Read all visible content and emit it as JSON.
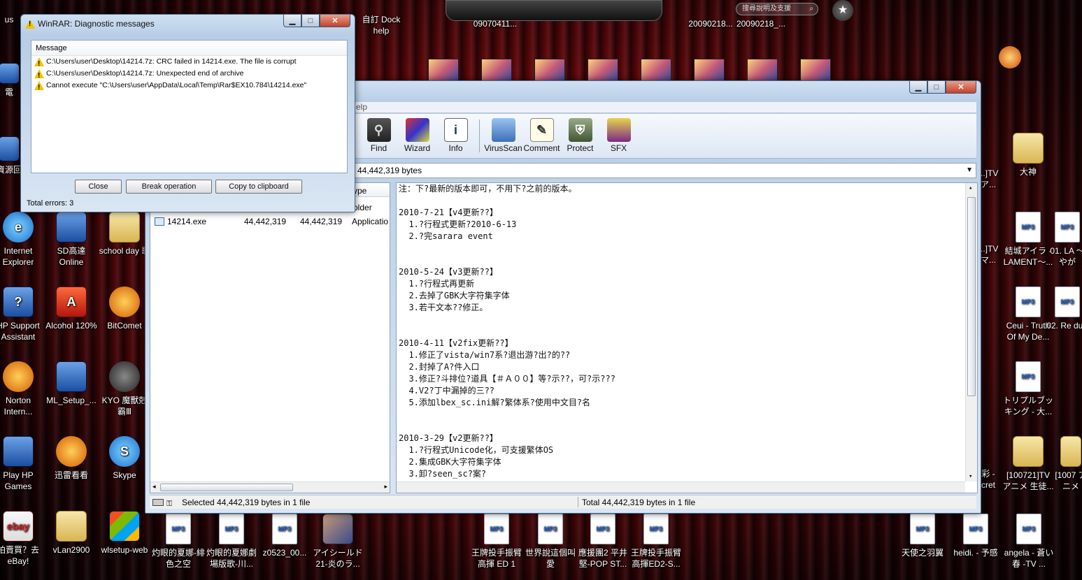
{
  "desktop": {
    "left_icons": [
      {
        "label": "Internet Explorer",
        "kind": "app"
      },
      {
        "label": "SD高達 Online",
        "kind": "app"
      },
      {
        "label": "school day 歌",
        "kind": "folder"
      },
      {
        "label": "HP Support Assistant",
        "kind": "app"
      },
      {
        "label": "Alcohol 120%",
        "kind": "red"
      },
      {
        "label": "BitComet",
        "kind": "orange"
      },
      {
        "label": "Norton Intern...",
        "kind": "orange"
      },
      {
        "label": "ML_Setup_...",
        "kind": "app"
      },
      {
        "label": "KYO 魔獸剋霸Ⅲ",
        "kind": "dark"
      },
      {
        "label": "Play HP Games",
        "kind": "app"
      },
      {
        "label": "迅雷看看",
        "kind": "orange"
      },
      {
        "label": "Skype",
        "kind": "blue"
      },
      {
        "label": "拍賣買？去 eBay!",
        "kind": "app"
      },
      {
        "label": "vLan2900",
        "kind": "folder"
      },
      {
        "label": "wlsetup-web",
        "kind": "app"
      }
    ],
    "bottom_icons": [
      {
        "label": "灼眼的夏娜-緋色之空"
      },
      {
        "label": "灼眼的夏娜劇場版歌-川..."
      },
      {
        "label": "z0523_00..."
      },
      {
        "label": "アイシールド21-炎のラ..."
      },
      {
        "label": "王牌投手振臂高揮 ED 1"
      },
      {
        "label": "世界說這個叫愛"
      },
      {
        "label": "應援團2 平井堅-POP ST..."
      },
      {
        "label": "王牌投手振臂高揮ED2-S..."
      },
      {
        "label": "天使之羽翼"
      },
      {
        "label": "heidi. - 予感"
      },
      {
        "label": "angela - 蒼い春 -TV ..."
      }
    ],
    "right_icons": [
      {
        "label": "大神"
      },
      {
        "label": "結城アイラ - LAMENT～..."
      },
      {
        "label": "01. LA ～やが"
      },
      {
        "label": "Ceui - Truth Of My De..."
      },
      {
        "label": "02. Re du )"
      },
      {
        "label": "トリプルブッキング - 大..."
      },
      {
        "label": "[100721]TV アニメ 生徒..."
      },
      {
        "label": "[1007 アニメ"
      }
    ],
    "partial_labels": {
      "left_edge_top": "us",
      "left_edge_2": "電",
      "left_edge_3": "資源回",
      "right_frag_1": "...]TV ア...",
      "right_frag_2": "...]TV マ...",
      "right_frag_3": "彩 - cret",
      "top_labels": [
        "自訂 Dock",
        "help",
        "09070411...",
        "20090218...",
        "20090218_..."
      ],
      "search_hint": "搜尋說明及支援"
    },
    "mp3_badge": "MP3"
  },
  "diag": {
    "title": "WinRAR: Diagnostic messages",
    "column": "Message",
    "messages": [
      "C:\\Users\\user\\Desktop\\14214.7z: CRC failed in 14214.exe. The file is corrupt",
      "C:\\Users\\user\\Desktop\\14214.7z: Unexpected end of archive",
      "Cannot execute \"C:\\Users\\user\\AppData\\Local\\Temp\\Rar$EX10.784\\14214.exe\""
    ],
    "buttons": {
      "close": "Close",
      "break": "Break operation",
      "copy": "Copy to clipboard"
    },
    "total": "Total errors: 3"
  },
  "main": {
    "menu_fragment": "elp",
    "toolbar": [
      {
        "label": "Find",
        "icon": "binoculars-icon"
      },
      {
        "label": "Wizard",
        "icon": "wizard-icon"
      },
      {
        "label": "Info",
        "icon": "info-icon"
      },
      {
        "label": "VirusScan",
        "icon": "virusscan-icon"
      },
      {
        "label": "Comment",
        "icon": "comment-icon"
      },
      {
        "label": "Protect",
        "icon": "shield-icon"
      },
      {
        "label": "SFX",
        "icon": "sfx-icon"
      }
    ],
    "path_text": "44,442,319 bytes",
    "columns": {
      "type": "ype"
    },
    "rows": [
      {
        "name": "",
        "size": "",
        "packed": "",
        "type": "older"
      },
      {
        "name": "14214.exe",
        "size": "44,442,319",
        "packed": "44,442,319",
        "type": "Applicatio"
      }
    ],
    "comment_lines": [
      "注：下?最新的版本即可，不用下?之前的版本。",
      "",
      "2010-7-21【v4更新??】",
      "  1.?行程式更新?2010-6-13",
      "  2.?完sarara event",
      "",
      "",
      "2010-5-24【v3更新??】",
      "  1.?行程式再更新",
      "  2.去掉了GBK大字符集字体",
      "  3.若干文本??修正。",
      "",
      "",
      "2010-4-11【v2fix更新??】",
      "  1.修正了vista/win7系?退出游?出?的??",
      "  2.封掉了A?件入口",
      "  3.修正?斗排位?道具【＃Ａ００】等?示??，可?示???",
      "  4.V2?丁中漏掉的三??",
      "  5.添加lbex_sc.ini解?繁体系?使用中文目?名",
      "",
      "",
      "2010-3-29【v2更新??】",
      "  1.?行程式Unicode化，可支援繁体OS",
      "  2.集成GBK大字符集字体",
      "  3.卸?seen_sc?案?"
    ],
    "status_left": "Selected 44,442,319 bytes in 1 file",
    "status_right": "Total 44,442,319 bytes in 1 file"
  }
}
